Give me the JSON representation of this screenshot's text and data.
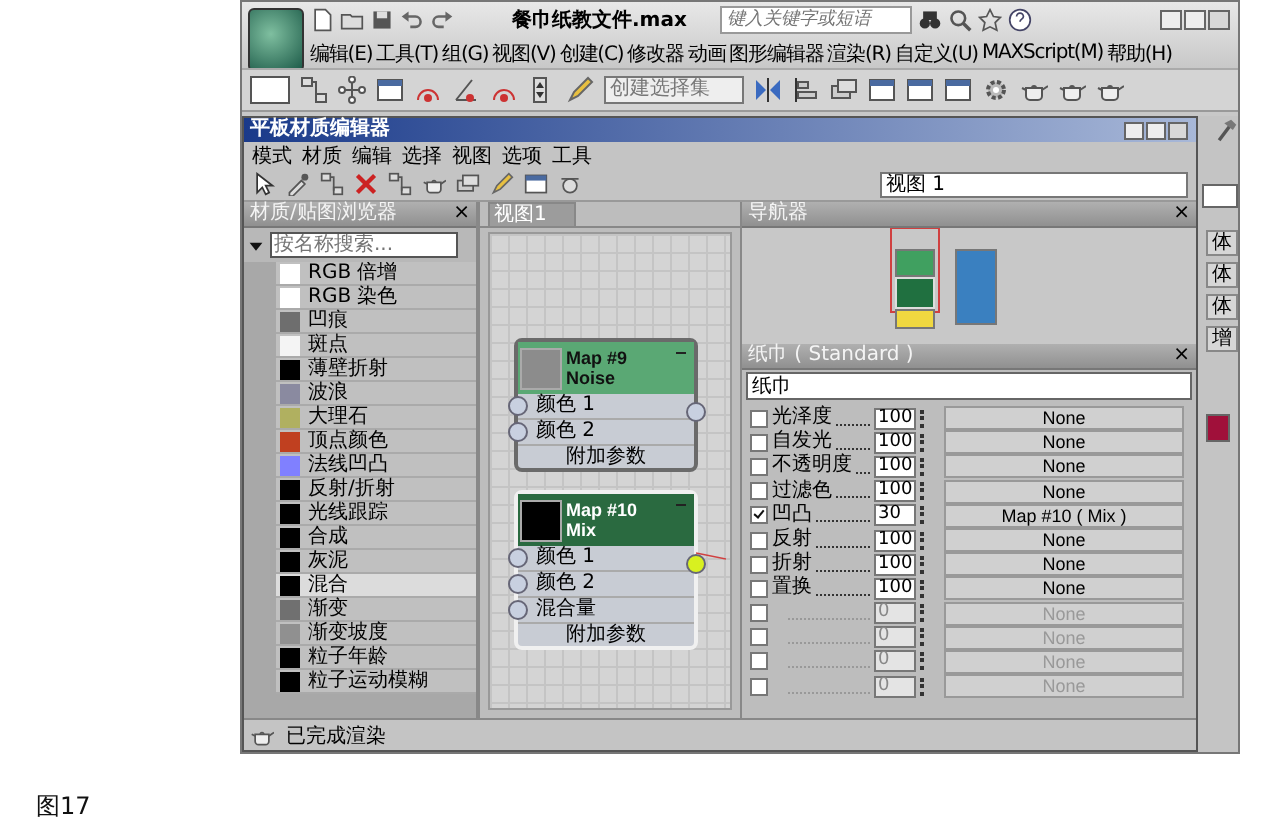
{
  "app": {
    "title": "餐巾纸教文件.max",
    "search_placeholder": "键入关键字或短语"
  },
  "menu": [
    "编辑(E)",
    "工具(T)",
    "组(G)",
    "视图(V)",
    "创建(C)",
    "修改器",
    "动画",
    "图形编辑器",
    "渲染(R)",
    "自定义(U)",
    "MAXScript(M)",
    "帮助(H)"
  ],
  "toolbar": {
    "selection_set": "创建选择集"
  },
  "editor": {
    "title": "平板材质编辑器",
    "menu": [
      "模式",
      "材质",
      "编辑",
      "选择",
      "视图",
      "选项",
      "工具"
    ],
    "view_select": "视图 1"
  },
  "browser": {
    "title": "材质/贴图浏览器",
    "close": "×",
    "search_placeholder": "按名称搜索...",
    "items": [
      {
        "label": "RGB 倍增",
        "color": "#ffffff",
        "selected": false
      },
      {
        "label": "RGB 染色",
        "color": "#ffffff",
        "selected": false
      },
      {
        "label": "凹痕",
        "color": "#6e6e6e",
        "selected": false
      },
      {
        "label": "斑点",
        "color": "#f4f4f4",
        "selected": false
      },
      {
        "label": "薄壁折射",
        "color": "#000000",
        "selected": false
      },
      {
        "label": "波浪",
        "color": "#8a8aa0",
        "selected": false
      },
      {
        "label": "大理石",
        "color": "#b0b060",
        "selected": false
      },
      {
        "label": "顶点颜色",
        "color": "#c04020",
        "selected": false
      },
      {
        "label": "法线凹凸",
        "color": "#8080ff",
        "selected": false
      },
      {
        "label": "反射/折射",
        "color": "#000000",
        "selected": false
      },
      {
        "label": "光线跟踪",
        "color": "#000000",
        "selected": false
      },
      {
        "label": "合成",
        "color": "#000000",
        "selected": false
      },
      {
        "label": "灰泥",
        "color": "#000000",
        "selected": false
      },
      {
        "label": "混合",
        "color": "#000000",
        "selected": true
      },
      {
        "label": "渐变",
        "color": "#707070",
        "selected": false
      },
      {
        "label": "渐变坡度",
        "color": "#909090",
        "selected": false
      },
      {
        "label": "粒子年龄",
        "color": "#000000",
        "selected": false
      },
      {
        "label": "粒子运动模糊",
        "color": "#000000",
        "selected": false
      }
    ]
  },
  "view_tab": {
    "label": "视图1",
    "selected": true
  },
  "nodes": [
    {
      "name": "Map #9",
      "type": "Noise",
      "color": "#8c8c8c",
      "selected": false,
      "slots": [
        "颜色 1",
        "颜色 2"
      ],
      "footer": "附加参数"
    },
    {
      "name": "Map #10",
      "type": "Mix",
      "color": "#000000",
      "selected": true,
      "slots": [
        "颜色 1",
        "颜色 2",
        "混合量"
      ],
      "footer": "附加参数"
    }
  ],
  "navigator": {
    "title": "导航器",
    "close": "×"
  },
  "material": {
    "title": "纸巾 ( Standard )",
    "close": "×",
    "name": "纸巾",
    "maps": [
      {
        "label": "光泽度",
        "checked": false,
        "amount": "100",
        "map": "None",
        "disabled": false
      },
      {
        "label": "自发光",
        "checked": false,
        "amount": "100",
        "map": "None",
        "disabled": false
      },
      {
        "label": "不透明度",
        "checked": false,
        "amount": "100",
        "map": "None",
        "disabled": false
      },
      {
        "label": "过滤色",
        "checked": false,
        "amount": "100",
        "map": "None",
        "disabled": false
      },
      {
        "label": "凹凸",
        "checked": true,
        "amount": "30",
        "map": "Map #10  ( Mix )",
        "disabled": false
      },
      {
        "label": "反射",
        "checked": false,
        "amount": "100",
        "map": "None",
        "disabled": false
      },
      {
        "label": "折射",
        "checked": false,
        "amount": "100",
        "map": "None",
        "disabled": false
      },
      {
        "label": "置换",
        "checked": false,
        "amount": "100",
        "map": "None",
        "disabled": false
      },
      {
        "checked": false,
        "amount": "0",
        "map": "None",
        "disabled": true
      },
      {
        "checked": false,
        "amount": "0",
        "map": "None",
        "disabled": true
      },
      {
        "checked": false,
        "amount": "0",
        "map": "None",
        "disabled": true
      },
      {
        "checked": false,
        "amount": "0",
        "map": "None",
        "disabled": true
      }
    ]
  },
  "command_panel": {
    "buttons": [
      "体",
      "体",
      "体",
      "增"
    ],
    "color": "#a0103a"
  },
  "status": "已完成渲染",
  "caption": "图17"
}
